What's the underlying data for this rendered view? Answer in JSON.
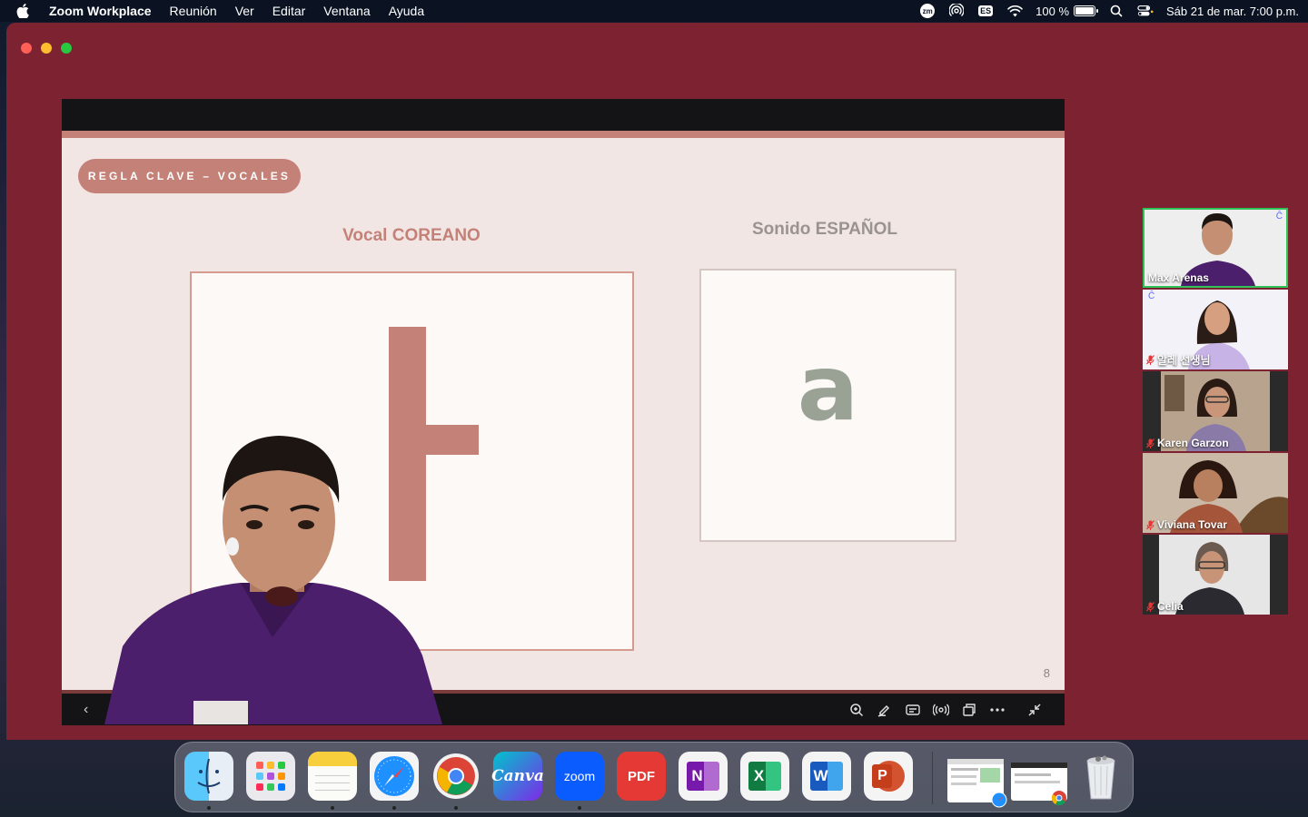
{
  "menubar": {
    "app_name": "Zoom Workplace",
    "menus": [
      "Reunión",
      "Ver",
      "Editar",
      "Ventana",
      "Ayuda"
    ],
    "battery_percent": "100 %",
    "battery_level": 1.0,
    "input_source": "ES",
    "datetime": "Sáb 21 de mar.  7:00 p.m."
  },
  "slide": {
    "rule_pill": "REGLA CLAVE – VOCALES",
    "heading_korean": "Vocal COREANO",
    "heading_spanish": "Sonido ESPAÑOL",
    "latin_letter": "a",
    "page_number": "8"
  },
  "participants": [
    {
      "name": "Max Arenas",
      "muted": false,
      "active": true
    },
    {
      "name": "알레 선생님",
      "muted": true,
      "active": false
    },
    {
      "name": "Karen Garzon",
      "muted": true,
      "active": false
    },
    {
      "name": "Viviana Tovar",
      "muted": true,
      "active": false
    },
    {
      "name": "Celia",
      "muted": true,
      "active": false
    }
  ],
  "dock": {
    "apps": [
      {
        "name": "Finder",
        "icon": "finder-icon",
        "running": true
      },
      {
        "name": "Launchpad",
        "icon": "launchpad-icon",
        "running": false
      },
      {
        "name": "Notes",
        "icon": "notes-icon",
        "running": true
      },
      {
        "name": "Safari",
        "icon": "safari-icon",
        "running": true
      },
      {
        "name": "Chrome",
        "icon": "chrome-icon",
        "running": true
      },
      {
        "name": "Canva",
        "label": "Canva",
        "icon": "canva-icon",
        "running": false
      },
      {
        "name": "Zoom",
        "label": "zoom",
        "icon": "zoom-icon",
        "running": true
      },
      {
        "name": "PDF",
        "label": "PDF",
        "icon": "pdf-icon",
        "running": false
      },
      {
        "name": "OneNote",
        "label": "N",
        "icon": "onenote-icon",
        "running": false
      },
      {
        "name": "Excel",
        "label": "X",
        "icon": "excel-icon",
        "running": false
      },
      {
        "name": "Word",
        "label": "W",
        "icon": "word-icon",
        "running": false
      },
      {
        "name": "PowerPoint",
        "label": "P",
        "icon": "powerpoint-icon",
        "running": false
      }
    ]
  },
  "colors": {
    "window": "#7d2231",
    "slide_accent": "#c48177",
    "active_speaker": "#32c25a"
  }
}
